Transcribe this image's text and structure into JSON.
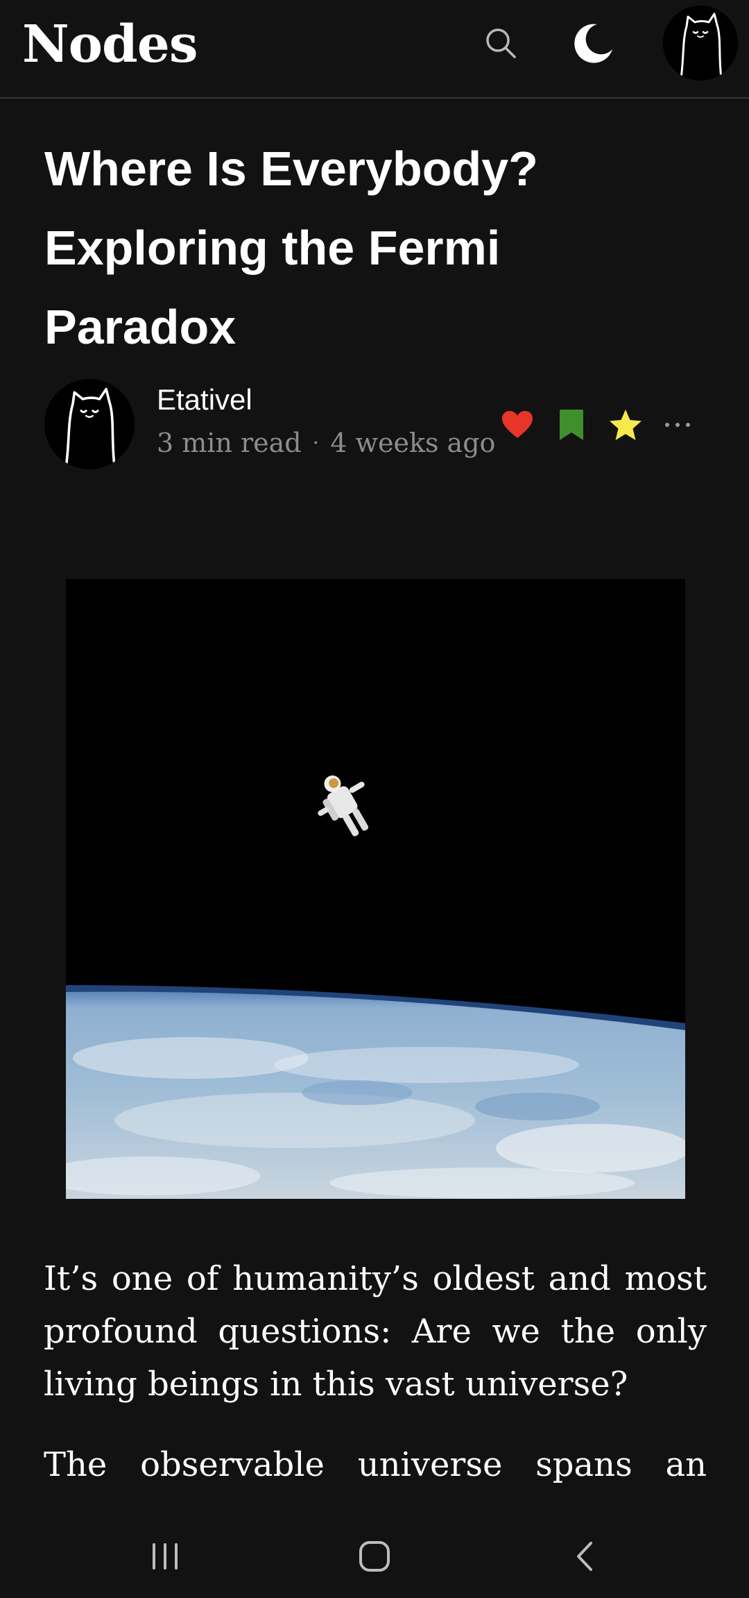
{
  "header": {
    "logo": "Nodes",
    "search_icon": "search-icon",
    "theme_icon": "moon-icon",
    "profile_icon": "cat-avatar"
  },
  "article": {
    "title": "Where Is Everybody? Exploring the Fermi Paradox",
    "author": "Etativel",
    "read_time": "3 min read",
    "separator": "·",
    "published": "4 weeks ago",
    "actions": {
      "like_icon": "heart-icon",
      "bookmark_icon": "bookmark-icon",
      "star_icon": "star-icon",
      "more_icon": "more-icon"
    },
    "paragraphs": [
      "It’s one of humanity’s oldest and most profound questions: Are we the only living beings in this vast universe?",
      "The observable universe spans an"
    ]
  },
  "colors": {
    "background": "#121212",
    "like": "#e8352a",
    "bookmark": "#3f8f2f",
    "star": "#f6e94a",
    "muted_text": "#8d8d8d"
  },
  "navbar": {
    "recents_icon": "recents-icon",
    "home_icon": "home-icon",
    "back_icon": "back-icon"
  }
}
